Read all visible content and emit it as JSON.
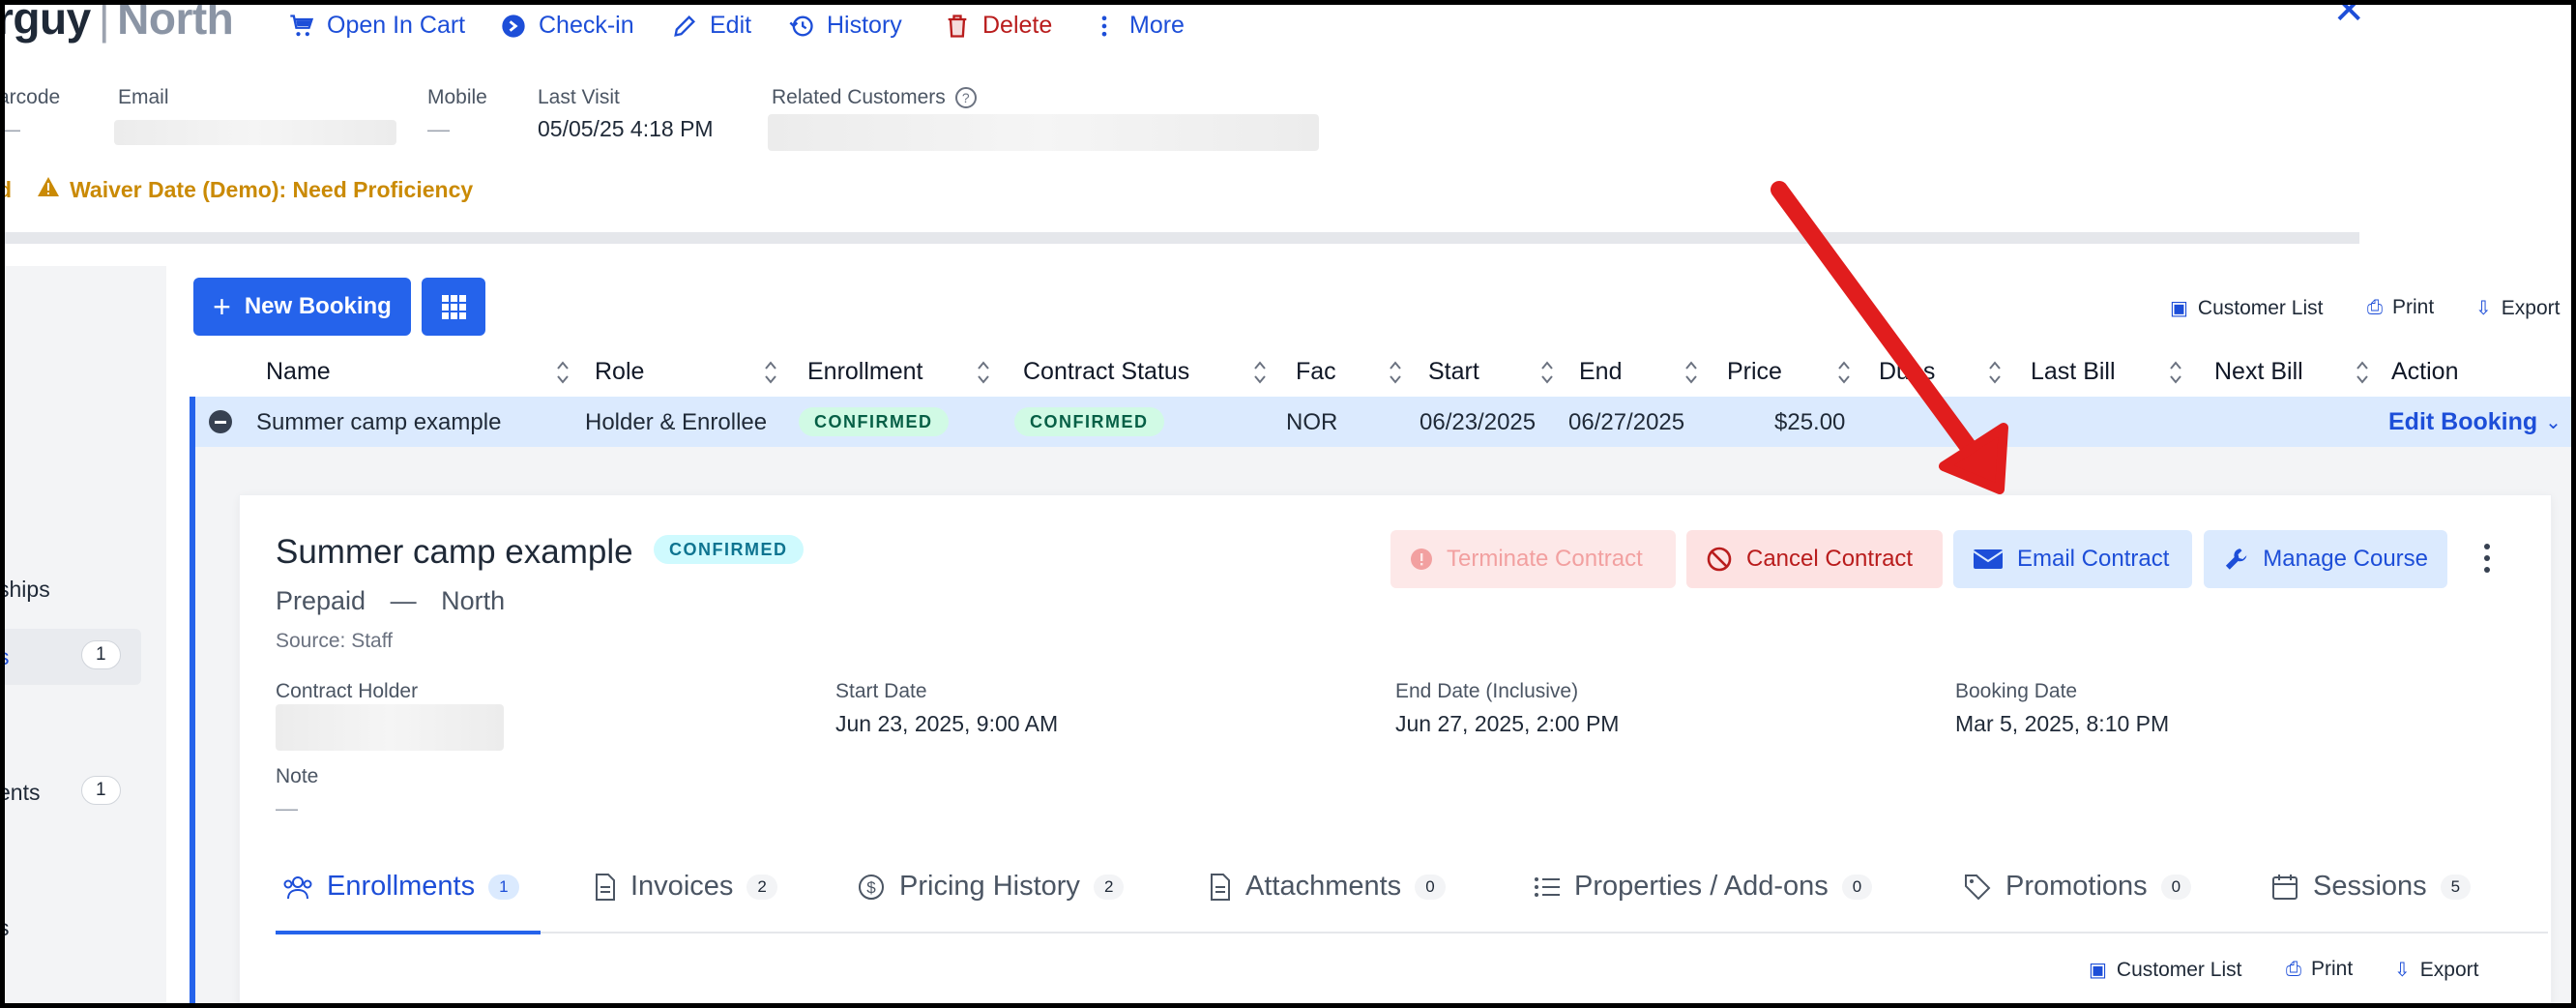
{
  "header": {
    "title_name": "rguy",
    "title_location": "North",
    "actions": [
      {
        "label": "Open In Cart",
        "icon": "cart-icon"
      },
      {
        "label": "Check-in",
        "icon": "check-in-icon"
      },
      {
        "label": "Edit",
        "icon": "pencil-icon"
      },
      {
        "label": "History",
        "icon": "history-icon"
      },
      {
        "label": "Delete",
        "icon": "trash-icon"
      },
      {
        "label": "More",
        "icon": "kebab-icon"
      }
    ],
    "close_glyph": "✕"
  },
  "fields": {
    "barcode_label": "arcode",
    "barcode_value": "—",
    "email_label": "Email",
    "mobile_label": "Mobile",
    "mobile_value": "—",
    "last_visit_label": "Last Visit",
    "last_visit_value": "05/05/25 4:18 PM",
    "related_label": "Related Customers"
  },
  "alerts": {
    "left_fragment": "d",
    "waiver": "Waiver Date (Demo): Need Proficiency"
  },
  "sidebar": {
    "items": [
      {
        "label": "ships"
      },
      {
        "label": "s",
        "count": "1"
      },
      {
        "label": "ents",
        "count": "1"
      },
      {
        "label": "s"
      }
    ]
  },
  "toolbar": {
    "new_booking": "New Booking",
    "customer_list": "Customer List",
    "print": "Print",
    "export": "Export"
  },
  "table": {
    "columns": [
      "Name",
      "Role",
      "Enrollment",
      "Contract Status",
      "Fac",
      "Start",
      "End",
      "Price",
      "Dues",
      "Last Bill",
      "Next Bill",
      "Action"
    ],
    "row": {
      "name": "Summer camp example",
      "role": "Holder & Enrollee",
      "enrollment": "CONFIRMED",
      "contract_status": "CONFIRMED",
      "fac": "NOR",
      "start": "06/23/2025",
      "end": "06/27/2025",
      "price": "$25.00",
      "action": "Edit Booking"
    }
  },
  "detail": {
    "title": "Summer camp example",
    "status": "CONFIRMED",
    "plan": "Prepaid",
    "dash": "—",
    "location": "North",
    "source": "Source: Staff",
    "buttons": {
      "terminate": "Terminate Contract",
      "cancel": "Cancel Contract",
      "email": "Email Contract",
      "manage": "Manage Course"
    },
    "contract_holder_label": "Contract Holder",
    "start_label": "Start Date",
    "start_value": "Jun 23, 2025, 9:00 AM",
    "end_label": "End Date (Inclusive)",
    "end_value": "Jun 27, 2025, 2:00 PM",
    "booking_label": "Booking Date",
    "booking_value": "Mar 5, 2025, 8:10 PM",
    "note_label": "Note",
    "note_value": "—",
    "tabs": [
      {
        "label": "Enrollments",
        "count": "1"
      },
      {
        "label": "Invoices",
        "count": "2"
      },
      {
        "label": "Pricing History",
        "count": "2"
      },
      {
        "label": "Attachments",
        "count": "0"
      },
      {
        "label": "Properties / Add-ons",
        "count": "0"
      },
      {
        "label": "Promotions",
        "count": "0"
      },
      {
        "label": "Sessions",
        "count": "5"
      }
    ],
    "sub_toolbar": {
      "customer_list": "Customer List",
      "print": "Print",
      "export": "Export"
    }
  },
  "colors": {
    "primary": "#2563eb",
    "danger": "#b91c1c",
    "warning": "#ca8a04",
    "annotation_arrow": "#e11d1d"
  }
}
